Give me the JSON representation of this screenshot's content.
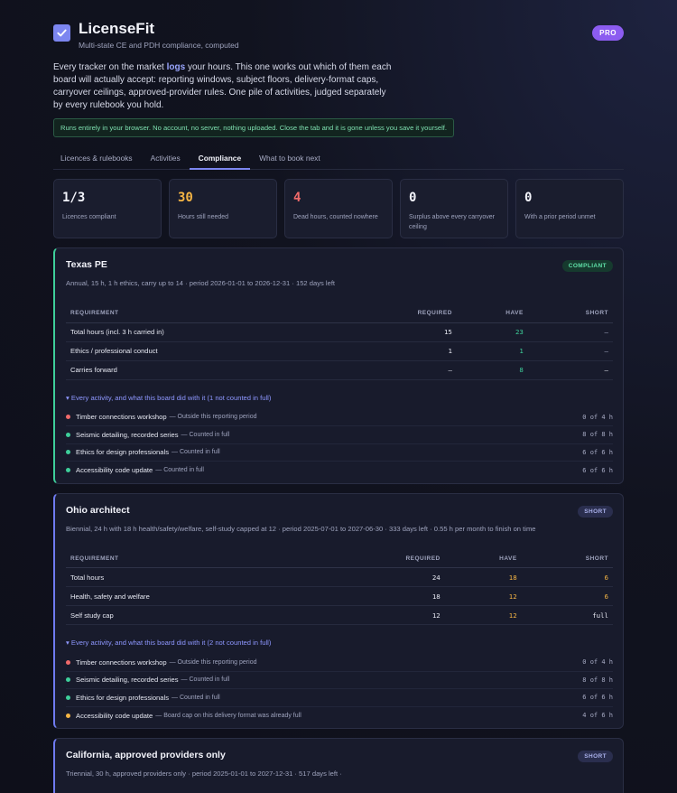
{
  "app": {
    "title": "LicenseFit",
    "subtitle": "Multi-state CE and PDH compliance, computed",
    "badge": "PRO",
    "intro_pre": "Every tracker on the market ",
    "intro_bold": "logs",
    "intro_post": " your hours. This one works out which of them each board will actually accept: reporting windows, subject floors, delivery-format caps, carryover ceilings, approved-provider rules. One pile of activities, judged separately by every rulebook you hold.",
    "privacy": "Runs entirely in your browser. No account, no server, nothing uploaded. Close the tab and it is gone unless you save it yourself."
  },
  "tabs": [
    {
      "label": "Licences & rulebooks",
      "active": false
    },
    {
      "label": "Activities",
      "active": false
    },
    {
      "label": "Compliance",
      "active": true
    },
    {
      "label": "What to book next",
      "active": false
    }
  ],
  "stats": [
    {
      "value": "1/3",
      "label": "Licences compliant",
      "color": "#f2f3fa"
    },
    {
      "value": "30",
      "label": "Hours still needed",
      "color": "#f5b544"
    },
    {
      "value": "4",
      "label": "Dead hours, counted nowhere",
      "color": "#f06a6a"
    },
    {
      "value": "0",
      "label": "Surplus above every carryover ceiling",
      "color": "#f2f3fa"
    },
    {
      "value": "0",
      "label": "With a prior period unmet",
      "color": "#f2f3fa"
    }
  ],
  "table_headers": {
    "requirement": "REQUIREMENT",
    "required": "REQUIRED",
    "have": "HAVE",
    "short": "SHORT"
  },
  "cards": [
    {
      "title": "Texas PE",
      "status": "COMPLIANT",
      "meta": "Annual, 15 h, 1 h ethics, carry up to 14 · period 2026-01-01 to 2026-12-31 · 152 days left",
      "rows": [
        {
          "req": "Total hours (incl. 3 h carried in)",
          "required": "15",
          "have": "23",
          "short": "–"
        },
        {
          "req": "Ethics / professional conduct",
          "required": "1",
          "have": "1",
          "short": "–"
        },
        {
          "req": "Carries forward",
          "required": "–",
          "have": "8",
          "short": "–"
        }
      ],
      "toggle": "▾ Every activity, and what this board did with it (1 not counted in full)",
      "activities": [
        {
          "name": "Timber connections workshop",
          "note": "— Outside this reporting period",
          "hours": "0 of 4 h",
          "color": "#f06a6a"
        },
        {
          "name": "Seismic detailing, recorded series",
          "note": "— Counted in full",
          "hours": "8 of 8 h",
          "color": "#3ecf9a"
        },
        {
          "name": "Ethics for design professionals",
          "note": "— Counted in full",
          "hours": "6 of 6 h",
          "color": "#3ecf9a"
        },
        {
          "name": "Accessibility code update",
          "note": "— Counted in full",
          "hours": "6 of 6 h",
          "color": "#3ecf9a"
        }
      ]
    },
    {
      "title": "Ohio architect",
      "status": "SHORT",
      "meta": "Biennial, 24 h with 18 h health/safety/welfare, self-study capped at 12 · period 2025-07-01 to 2027-06-30 · 333 days left · 0.55 h per month to finish on time",
      "rows": [
        {
          "req": "Total hours",
          "required": "24",
          "have": "18",
          "short": "6"
        },
        {
          "req": "Health, safety and welfare",
          "required": "18",
          "have": "12",
          "short": "6"
        },
        {
          "req": "Self study cap",
          "required": "12",
          "have": "12",
          "short": "full"
        }
      ],
      "toggle": "▾ Every activity, and what this board did with it (2 not counted in full)",
      "activities": [
        {
          "name": "Timber connections workshop",
          "note": "— Outside this reporting period",
          "hours": "0 of 4 h",
          "color": "#f06a6a"
        },
        {
          "name": "Seismic detailing, recorded series",
          "note": "— Counted in full",
          "hours": "8 of 8 h",
          "color": "#3ecf9a"
        },
        {
          "name": "Ethics for design professionals",
          "note": "— Counted in full",
          "hours": "6 of 6 h",
          "color": "#3ecf9a"
        },
        {
          "name": "Accessibility code update",
          "note": "— Board cap on this delivery format was already full",
          "hours": "4 of 6 h",
          "color": "#f5b544"
        }
      ]
    },
    {
      "title": "California, approved providers only",
      "status": "SHORT",
      "meta": "Triennial, 30 h, approved providers only · period 2025-01-01 to 2027-12-31 · 517 days left ·"
    }
  ]
}
